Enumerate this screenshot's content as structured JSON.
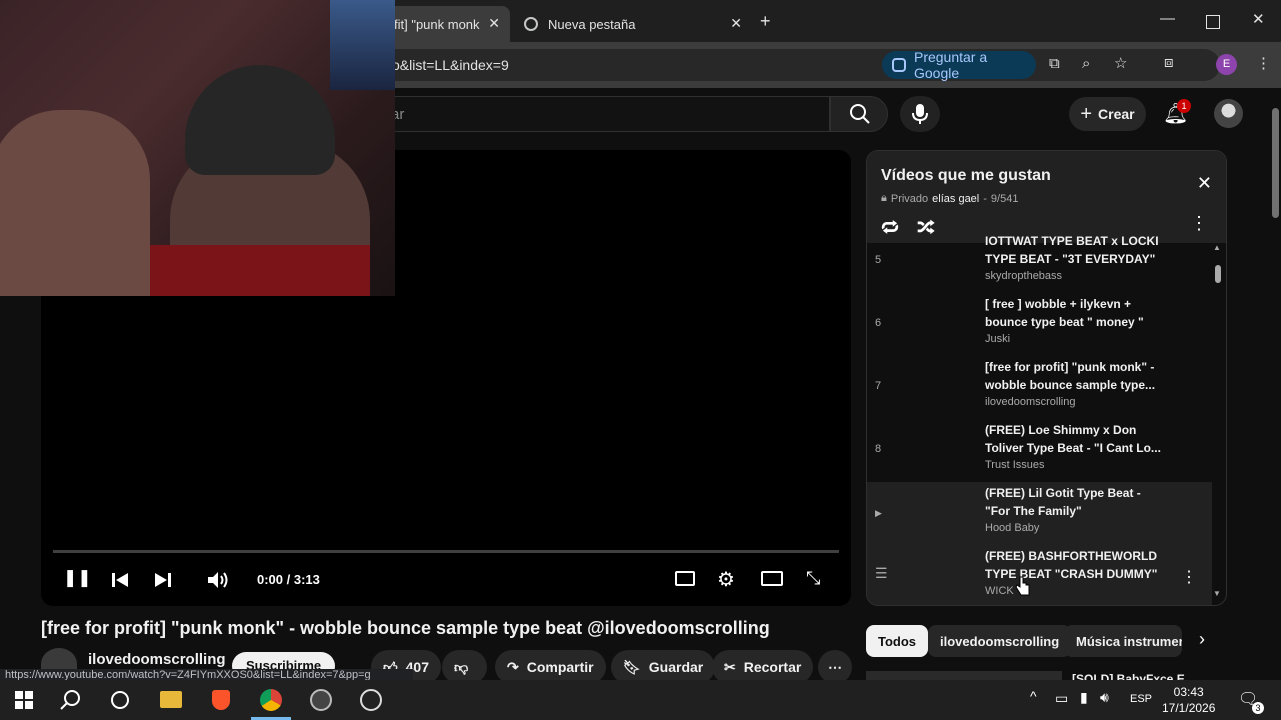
{
  "browser": {
    "tabs": [
      {
        "label": "[free for profit] \"punk monk\"",
        "visible_label": "fit] \"punk monk"
      },
      {
        "label": "Nueva pestaña"
      }
    ],
    "url": "o&list=LL&index=9",
    "ask_google": "Preguntar a Google",
    "profile_initial": "E"
  },
  "youtube": {
    "search_placeholder": "ar",
    "create_label": "Crear",
    "notification_count": "1"
  },
  "player": {
    "time": "0:00 / 3:13",
    "progress": 0.0
  },
  "video": {
    "title": "[free for profit] \"punk monk\" - wobble bounce sample type beat @ilovedoomscrolling",
    "channel": "ilovedoomscrolling",
    "subscribe": "Suscribirme",
    "likes": "407",
    "share": "Compartir",
    "save": "Guardar",
    "clip": "Recortar"
  },
  "status_url": "https://www.youtube.com/watch?v=Z4FIYmXXOS0&list=LL&index=7&pp=g",
  "playlist": {
    "title": "Vídeos que me gustan",
    "privacy": "Privado",
    "owner": "elías gael",
    "position": "9/541",
    "items": [
      {
        "index": "5",
        "title_line1": "IOTTWAT TYPE BEAT x LOCKI",
        "title_line2": "TYPE BEAT - \"3T EVERYDAY\"",
        "channel": "skydropthebass"
      },
      {
        "index": "6",
        "title_line1": "[ free ] wobble + ilykevn +",
        "title_line2": "bounce type beat \" money \"",
        "channel": "Juski"
      },
      {
        "index": "7",
        "title_line1": "[free for profit] \"punk monk\" -",
        "title_line2": "wobble bounce sample type...",
        "channel": "ilovedoomscrolling"
      },
      {
        "index": "8",
        "title_line1": "(FREE) Loe Shimmy x Don",
        "title_line2": "Toliver Type Beat - \"I Cant Lo...",
        "channel": "Trust Issues"
      },
      {
        "index": "▶",
        "title_line1": "(FREE) Lil Gotit Type Beat -",
        "title_line2": "\"For The Family\"",
        "channel": "Hood Baby"
      },
      {
        "index": "",
        "title_line1": "(FREE) BASHFORTHEWORLD",
        "title_line2": "TYPE BEAT \"CRASH DUMMY\"",
        "channel": "WICK"
      }
    ]
  },
  "chips": [
    "Todos",
    "ilovedoomscrolling",
    "Música instrumen"
  ],
  "next_video_title": "[SOLD] BabyFxce E",
  "taskbar": {
    "language": "ESP",
    "time": "03:43",
    "date": "17/1/2026",
    "notif_count": "3"
  },
  "colors": {
    "accent": "#3ea6ff",
    "badge_red": "#cc0000",
    "background": "#0f0f0f"
  }
}
